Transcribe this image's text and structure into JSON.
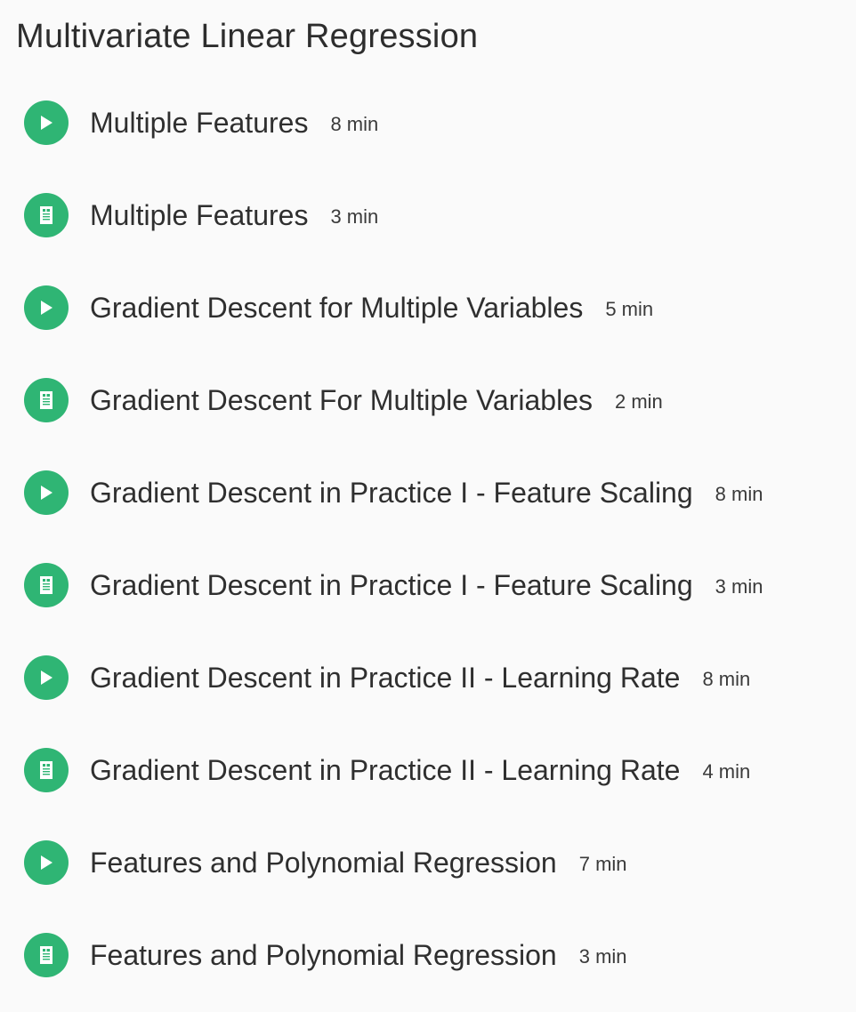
{
  "section": {
    "title": "Multivariate Linear Regression"
  },
  "lessons": [
    {
      "type": "video",
      "icon": "play-icon",
      "title": "Multiple Features",
      "duration": "8 min"
    },
    {
      "type": "reading",
      "icon": "document-icon",
      "title": "Multiple Features",
      "duration": "3 min"
    },
    {
      "type": "video",
      "icon": "play-icon",
      "title": "Gradient Descent for Multiple Variables",
      "duration": "5 min"
    },
    {
      "type": "reading",
      "icon": "document-icon",
      "title": "Gradient Descent For Multiple Variables",
      "duration": "2 min"
    },
    {
      "type": "video",
      "icon": "play-icon",
      "title": "Gradient Descent in Practice I - Feature Scaling",
      "duration": "8 min"
    },
    {
      "type": "reading",
      "icon": "document-icon",
      "title": "Gradient Descent in Practice I - Feature Scaling",
      "duration": "3 min"
    },
    {
      "type": "video",
      "icon": "play-icon",
      "title": "Gradient Descent in Practice II - Learning Rate",
      "duration": "8 min"
    },
    {
      "type": "reading",
      "icon": "document-icon",
      "title": "Gradient Descent in Practice II - Learning Rate",
      "duration": "4 min"
    },
    {
      "type": "video",
      "icon": "play-icon",
      "title": "Features and Polynomial Regression",
      "duration": "7 min"
    },
    {
      "type": "reading",
      "icon": "document-icon",
      "title": "Features and Polynomial Regression",
      "duration": "3 min"
    }
  ],
  "colors": {
    "accent": "#2fb574",
    "background": "#fafafa",
    "text": "#2f2f2f"
  }
}
